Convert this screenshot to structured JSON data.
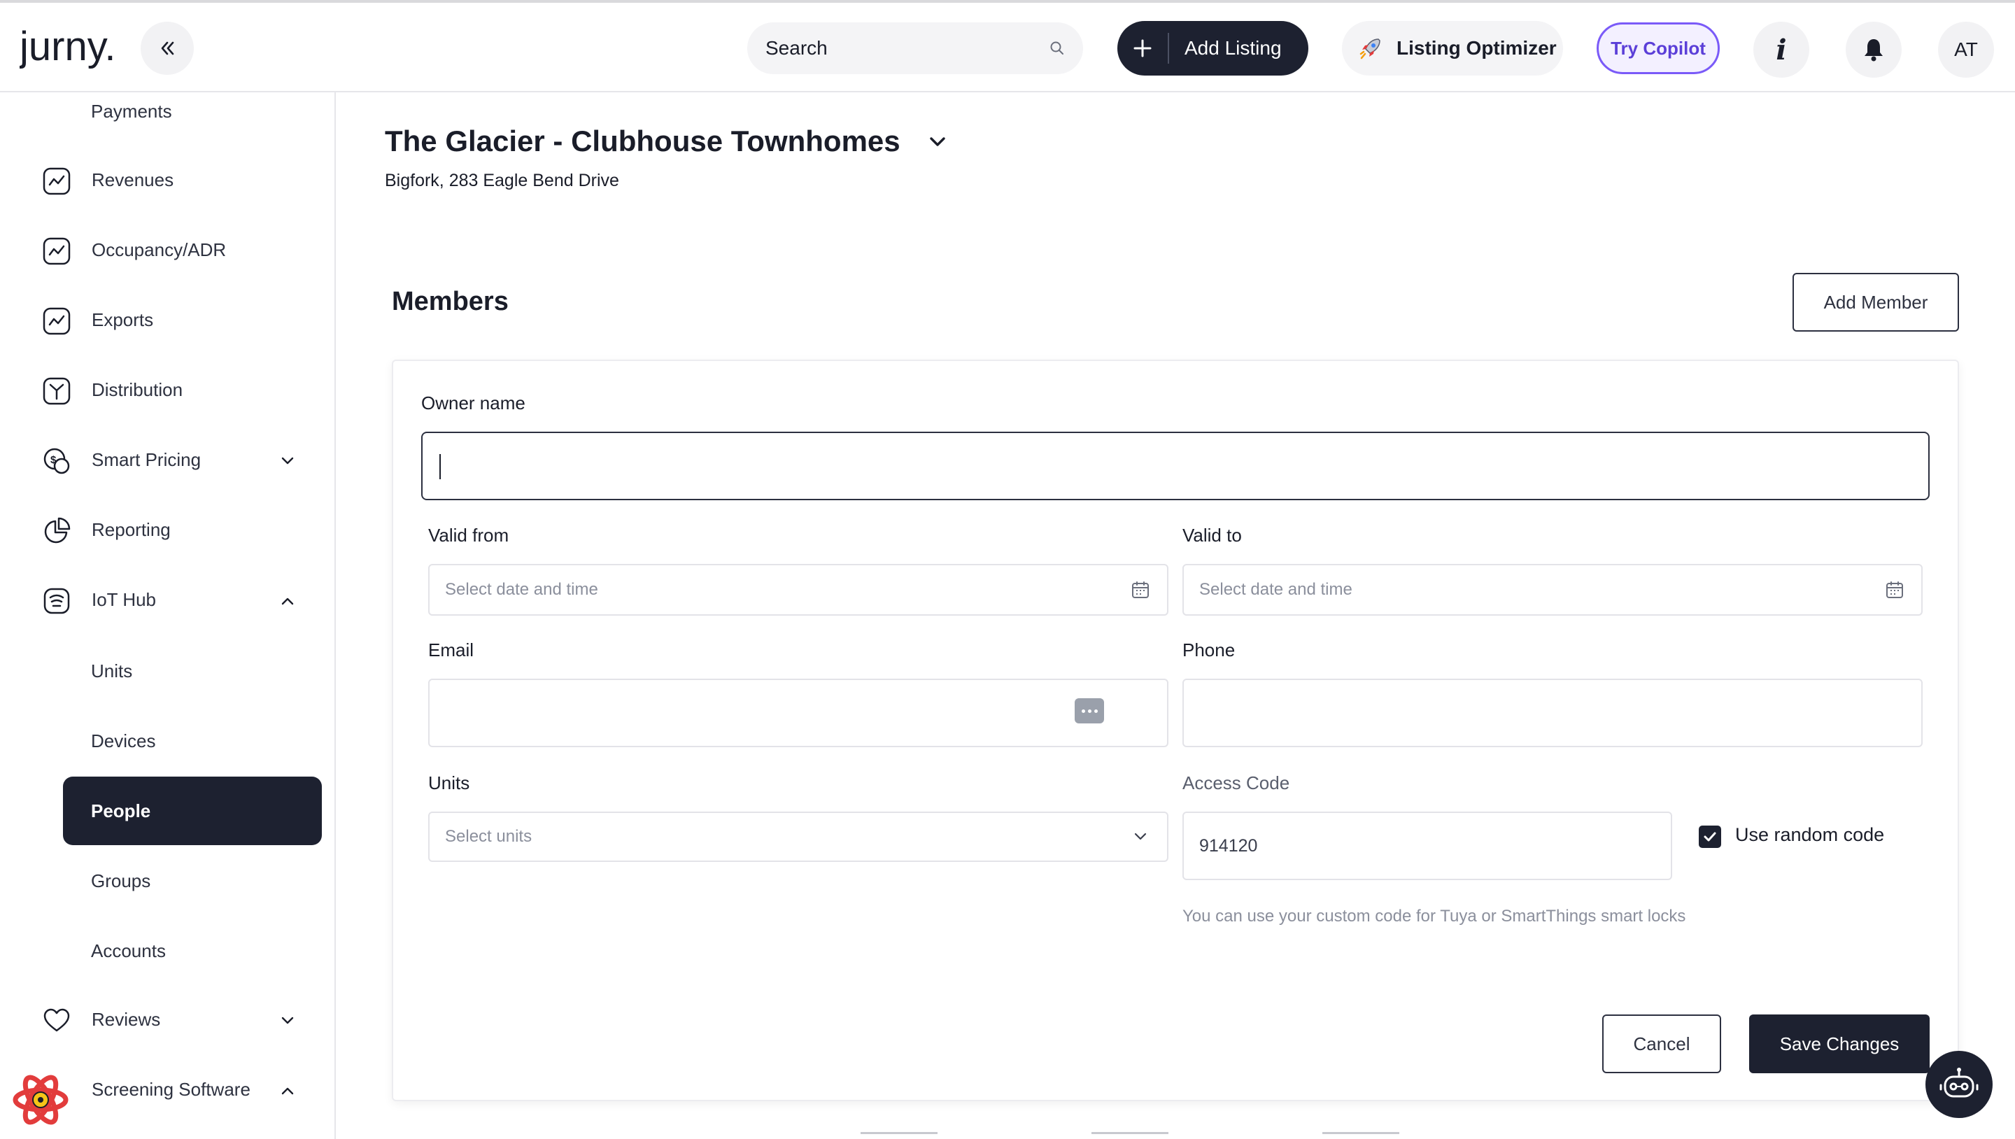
{
  "header": {
    "logo_text": "jurny.",
    "search_label": "Search",
    "add_listing_label": "Add Listing",
    "listing_optimizer_label": "Listing Optimizer",
    "try_copilot_label": "Try Copilot",
    "info_label": "i",
    "avatar_initials": "AT"
  },
  "sidebar": {
    "items": [
      {
        "label": "Payments",
        "icon": "none"
      },
      {
        "label": "Revenues",
        "icon": "chart-line-icon"
      },
      {
        "label": "Occupancy/ADR",
        "icon": "chart-line-icon"
      },
      {
        "label": "Exports",
        "icon": "chart-line-icon"
      },
      {
        "label": "Distribution",
        "icon": "distribution-icon"
      },
      {
        "label": "Smart Pricing",
        "icon": "smart-pricing-icon",
        "expanded": false
      },
      {
        "label": "Reporting",
        "icon": "pie-chart-icon"
      },
      {
        "label": "IoT Hub",
        "icon": "iot-hub-icon",
        "expanded": true
      },
      {
        "label": "Units"
      },
      {
        "label": "Devices"
      },
      {
        "label": "People",
        "active": true
      },
      {
        "label": "Groups"
      },
      {
        "label": "Accounts"
      },
      {
        "label": "Reviews",
        "icon": "heart-icon",
        "expanded": false
      },
      {
        "label": "Screening Software",
        "icon": "screening-logo-icon",
        "expanded": true
      }
    ]
  },
  "main": {
    "listing_title": "The Glacier - Clubhouse Townhomes",
    "listing_address": "Bigfork, 283 Eagle Bend Drive",
    "members_heading": "Members",
    "add_member_label": "Add Member"
  },
  "form": {
    "owner_name_label": "Owner name",
    "owner_name_value": "",
    "valid_from_label": "Valid from",
    "valid_from_placeholder": "Select date and time",
    "valid_to_label": "Valid to",
    "valid_to_placeholder": "Select date and time",
    "email_label": "Email",
    "phone_label": "Phone",
    "units_label": "Units",
    "units_placeholder": "Select units",
    "access_code_label": "Access Code",
    "access_code_value": "914120",
    "use_random_code_label": "Use random code",
    "use_random_code_checked": true,
    "access_code_hint": "You can use your custom code for Tuya or SmartThings smart locks",
    "cancel_label": "Cancel",
    "save_label": "Save Changes"
  },
  "colors": {
    "dark": "#1d2130",
    "copilot_accent": "#7a5af8",
    "muted_text": "#8b8f9c"
  }
}
